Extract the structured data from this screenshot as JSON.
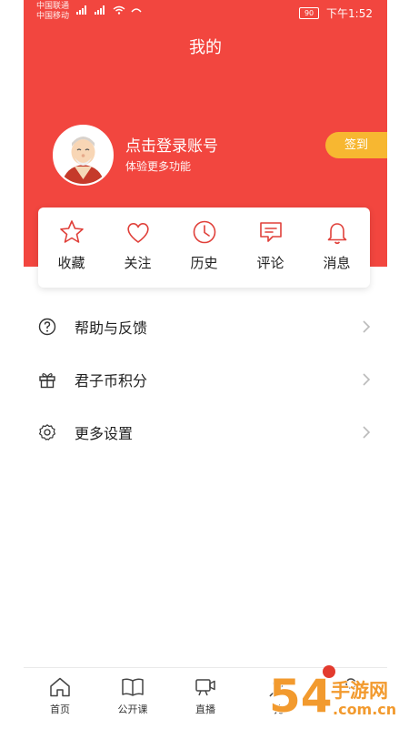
{
  "status_bar": {
    "carrier_1": "中国联通",
    "carrier_2": "中国移动",
    "battery": "90",
    "time": "下午1:52"
  },
  "header": {
    "title": "我的"
  },
  "profile": {
    "login_text": "点击登录账号",
    "login_sub": "体验更多功能",
    "signin_label": "签到"
  },
  "quick_actions": [
    {
      "label": "收藏",
      "icon": "star-icon"
    },
    {
      "label": "关注",
      "icon": "heart-icon"
    },
    {
      "label": "历史",
      "icon": "clock-icon"
    },
    {
      "label": "评论",
      "icon": "comment-icon"
    },
    {
      "label": "消息",
      "icon": "bell-icon"
    }
  ],
  "menu": [
    {
      "label": "帮助与反馈",
      "icon": "help-icon"
    },
    {
      "label": "君子币积分",
      "icon": "gift-icon"
    },
    {
      "label": "更多设置",
      "icon": "settings-icon"
    }
  ],
  "tabbar": [
    {
      "label": "首页",
      "icon": "home-icon"
    },
    {
      "label": "公开课",
      "icon": "book-icon"
    },
    {
      "label": "直播",
      "icon": "video-icon"
    },
    {
      "label": "孔",
      "icon": "confucius-icon"
    }
  ],
  "watermark": {
    "text_main": "54",
    "text_sub": "手游网",
    "text_url": ".com.cn"
  },
  "colors": {
    "brand_red": "#f2463f",
    "signin_gold": "#f7b731",
    "icon_red": "#e0403a"
  }
}
